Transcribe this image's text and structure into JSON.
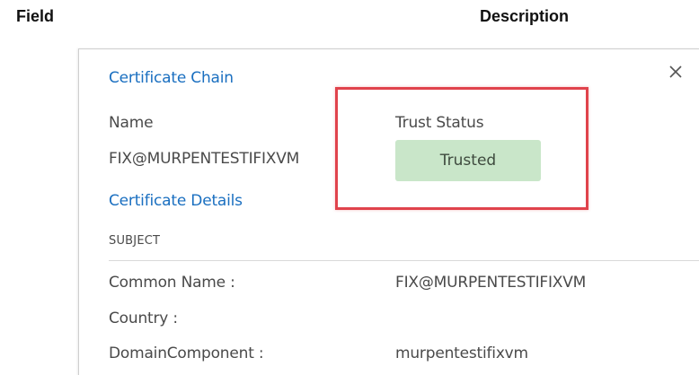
{
  "columns": {
    "field": "Field",
    "description": "Description"
  },
  "dialog": {
    "certificate_chain_title": "Certificate Chain",
    "name_label": "Name",
    "name_value": "FIX@MURPENTESTIFIXVM",
    "trust_status_label": "Trust Status",
    "trust_status_value": "Trusted",
    "certificate_details_title": "Certificate Details",
    "subject_header": "SUBJECT",
    "subject_rows": [
      {
        "label": "Common Name :",
        "value": "FIX@MURPENTESTIFIXVM"
      },
      {
        "label": "Country :",
        "value": ""
      },
      {
        "label": "DomainComponent :",
        "value": "murpentestifixvm"
      }
    ],
    "close_icon": "close-icon"
  },
  "colors": {
    "link_blue": "#1a6fc0",
    "trusted_badge_bg": "#c9e6c9",
    "highlight_red": "#e0434c"
  }
}
